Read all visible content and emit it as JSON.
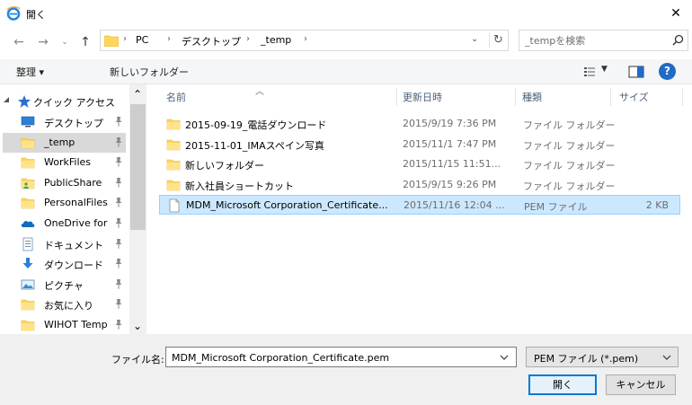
{
  "window": {
    "title": "開く"
  },
  "address": {
    "crumbs": [
      "PC",
      "デスクトップ",
      "_temp"
    ]
  },
  "search": {
    "placeholder": "_tempを検索"
  },
  "toolbar": {
    "organize": "整理 ▾",
    "new_folder": "新しいフォルダー",
    "help": "?"
  },
  "nav": {
    "quick_access": "クイック アクセス",
    "items": [
      {
        "label": "デスクトップ",
        "icon": "desktop-icon",
        "pinned": true
      },
      {
        "label": "_temp",
        "icon": "folder-icon",
        "pinned": true,
        "selected": true
      },
      {
        "label": "WorkFiles",
        "icon": "folder-icon",
        "pinned": true
      },
      {
        "label": "PublicShare",
        "icon": "public-folder-icon",
        "pinned": true
      },
      {
        "label": "PersonalFiles",
        "icon": "folder-icon",
        "pinned": true
      },
      {
        "label": "OneDrive for",
        "icon": "onedrive-icon",
        "pinned": true
      },
      {
        "label": "ドキュメント",
        "icon": "documents-icon",
        "pinned": true
      },
      {
        "label": "ダウンロード",
        "icon": "downloads-icon",
        "pinned": true
      },
      {
        "label": "ピクチャ",
        "icon": "pictures-icon",
        "pinned": true
      },
      {
        "label": "お気に入り",
        "icon": "folder-icon",
        "pinned": true
      },
      {
        "label": "WIHOT Temp",
        "icon": "folder-icon",
        "pinned": true
      }
    ]
  },
  "columns": {
    "name": "名前",
    "modified": "更新日時",
    "type": "種類",
    "size": "サイズ"
  },
  "files": [
    {
      "name": "2015-09-19_電話ダウンロード",
      "modified": "2015/9/19 7:36 PM",
      "type": "ファイル フォルダー",
      "size": "",
      "icon": "folder-icon"
    },
    {
      "name": "2015-11-01_IMAスペイン写真",
      "modified": "2015/11/1 7:47 PM",
      "type": "ファイル フォルダー",
      "size": "",
      "icon": "folder-icon"
    },
    {
      "name": "新しいフォルダー",
      "modified": "2015/11/15 11:51...",
      "type": "ファイル フォルダー",
      "size": "",
      "icon": "folder-icon"
    },
    {
      "name": "新入社員ショートカット",
      "modified": "2015/9/15 9:26 PM",
      "type": "ファイル フォルダー",
      "size": "",
      "icon": "folder-icon"
    },
    {
      "name": "MDM_Microsoft Corporation_Certificate...",
      "modified": "2015/11/16 12:04 ...",
      "type": "PEM ファイル",
      "size": "2 KB",
      "icon": "file-icon",
      "selected": true
    }
  ],
  "bottom": {
    "filename_label": "ファイル名:",
    "filename_value": "MDM_Microsoft Corporation_Certificate.pem",
    "filetype": "PEM ファイル (*.pem)",
    "open": "開く",
    "cancel": "キャンセル"
  },
  "colors": {
    "accent": "#0078d7",
    "selection": "#cce8ff",
    "folder": "#ffd65c"
  }
}
